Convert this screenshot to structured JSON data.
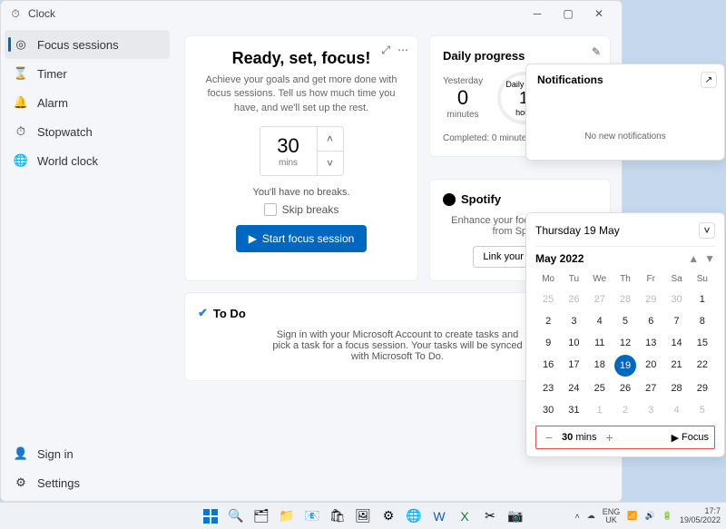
{
  "window": {
    "title": "Clock"
  },
  "sidebar": {
    "items": [
      {
        "label": "Focus sessions",
        "icon": "focus"
      },
      {
        "label": "Timer",
        "icon": "timer"
      },
      {
        "label": "Alarm",
        "icon": "alarm"
      },
      {
        "label": "Stopwatch",
        "icon": "stopwatch"
      },
      {
        "label": "World clock",
        "icon": "world"
      }
    ],
    "signin": "Sign in",
    "settings": "Settings"
  },
  "focus": {
    "heading": "Ready, set, focus!",
    "sub": "Achieve your goals and get more done with focus sessions. Tell us how much time you have, and we'll set up the rest.",
    "minutes": "30",
    "mins_label": "mins",
    "breaks": "You'll have no breaks.",
    "skip": "Skip breaks",
    "start": "Start focus session"
  },
  "daily": {
    "title": "Daily progress",
    "yesterday_label": "Yesterday",
    "yesterday_value": "0",
    "yesterday_unit": "minutes",
    "goal_label": "Daily goal",
    "goal_value": "1",
    "goal_unit": "hour",
    "completed": "Completed: 0 minutes"
  },
  "spotify": {
    "title": "Spotify",
    "sub": "Enhance your focus with music from Spotify.",
    "link": "Link your Spotify"
  },
  "todo": {
    "title": "To Do",
    "sub": "Sign in with your Microsoft Account to create tasks and pick a task for a focus session. Your tasks will be synced with Microsoft To Do."
  },
  "notifications": {
    "title": "Notifications",
    "empty": "No new notifications"
  },
  "calendar": {
    "date_line": "Thursday 19 May",
    "month": "May 2022",
    "dow": [
      "Mo",
      "Tu",
      "We",
      "Th",
      "Fr",
      "Sa",
      "Su"
    ],
    "days": [
      {
        "d": "25",
        "out": true
      },
      {
        "d": "26",
        "out": true
      },
      {
        "d": "27",
        "out": true
      },
      {
        "d": "28",
        "out": true
      },
      {
        "d": "29",
        "out": true
      },
      {
        "d": "30",
        "out": true
      },
      {
        "d": "1"
      },
      {
        "d": "2"
      },
      {
        "d": "3"
      },
      {
        "d": "4"
      },
      {
        "d": "5"
      },
      {
        "d": "6"
      },
      {
        "d": "7"
      },
      {
        "d": "8"
      },
      {
        "d": "9"
      },
      {
        "d": "10"
      },
      {
        "d": "11"
      },
      {
        "d": "12"
      },
      {
        "d": "13"
      },
      {
        "d": "14"
      },
      {
        "d": "15"
      },
      {
        "d": "16"
      },
      {
        "d": "17"
      },
      {
        "d": "18"
      },
      {
        "d": "19",
        "today": true
      },
      {
        "d": "20"
      },
      {
        "d": "21"
      },
      {
        "d": "22"
      },
      {
        "d": "23"
      },
      {
        "d": "24"
      },
      {
        "d": "25"
      },
      {
        "d": "26"
      },
      {
        "d": "27"
      },
      {
        "d": "28"
      },
      {
        "d": "29"
      },
      {
        "d": "30"
      },
      {
        "d": "31"
      },
      {
        "d": "1",
        "out": true
      },
      {
        "d": "2",
        "out": true
      },
      {
        "d": "3",
        "out": true
      },
      {
        "d": "4",
        "out": true
      },
      {
        "d": "5",
        "out": true
      }
    ],
    "focus_value": "30",
    "focus_unit": "mins",
    "focus_btn": "Focus"
  },
  "taskbar": {
    "lang": "ENG\nUK",
    "time": "17:7",
    "date": "19/05/2022"
  }
}
